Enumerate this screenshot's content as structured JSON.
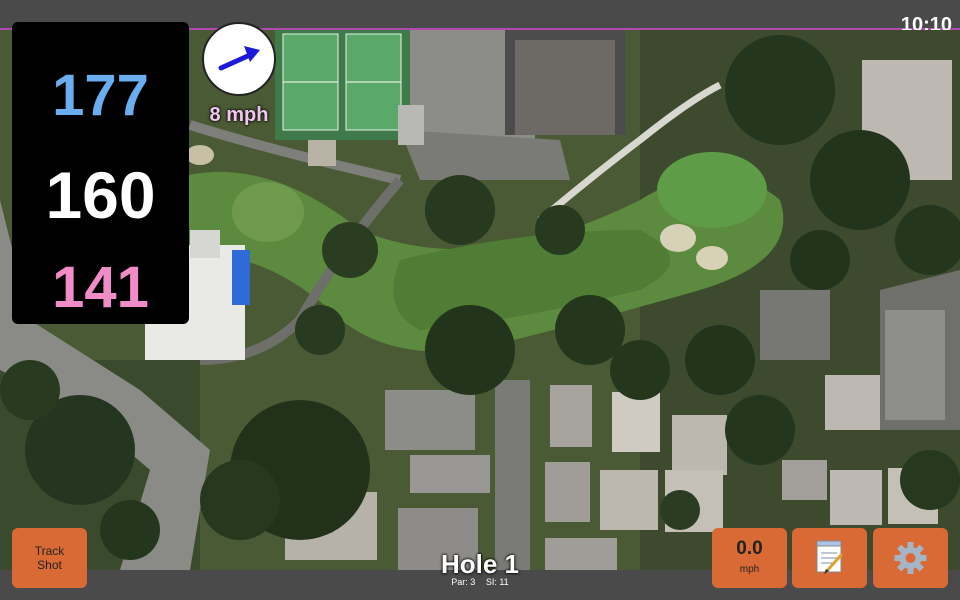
{
  "status": {
    "time": "10:10"
  },
  "distances": {
    "back": "177",
    "back_color": "#6aaef0",
    "center": "160",
    "center_color": "#ffffff",
    "front": "141",
    "front_color": "#f08cc8"
  },
  "wind": {
    "icon": "wind-arrow-icon",
    "speed_label": "8 mph",
    "label_color": "#f2c4f0"
  },
  "hole": {
    "title": "Hole 1",
    "par": "Par: 3",
    "stroke_index": "SI: 11"
  },
  "buttons": {
    "track_shot_line1": "Track",
    "track_shot_line2": "Shot",
    "speed_value": "0.0",
    "speed_unit": "mph",
    "notes_icon": "notepad-icon",
    "settings_icon": "gear-icon",
    "accent": "#d96a35"
  }
}
